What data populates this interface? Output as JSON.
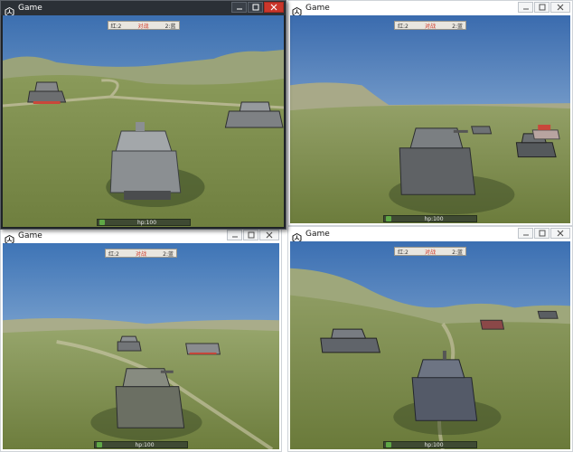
{
  "windows": [
    {
      "title": "Game",
      "hud": {
        "left": "红:2",
        "center": "对战",
        "right": "2:蓝"
      },
      "hp_text": "hp:100",
      "hp_fraction": 1.0
    },
    {
      "title": "Game",
      "hud": {
        "left": "红:2",
        "center": "对战",
        "right": "2:蓝"
      },
      "hp_text": "hp:100",
      "hp_fraction": 1.0
    },
    {
      "title": "Game",
      "hud": {
        "left": "红:2",
        "center": "对战",
        "right": "2:蓝"
      },
      "hp_text": "hp:100",
      "hp_fraction": 1.0
    },
    {
      "title": "Game",
      "hud": {
        "left": "红:2",
        "center": "对战",
        "right": "2:蓝"
      },
      "hp_text": "hp:100",
      "hp_fraction": 1.0
    }
  ],
  "icons": {
    "app": "unity-icon",
    "minimize": "minimize-icon",
    "maximize": "maximize-icon",
    "close": "close-icon",
    "hp": "health-icon"
  },
  "colors": {
    "active_titlebar": "#2b3036",
    "close_button": "#c9362b",
    "sky_top": "#3c6fb0",
    "sky_bottom": "#a9c8e3",
    "grass": "#7d8c4c",
    "hud_enemy_text": "#d03a2a",
    "hp_bar": "#3f4a33"
  }
}
